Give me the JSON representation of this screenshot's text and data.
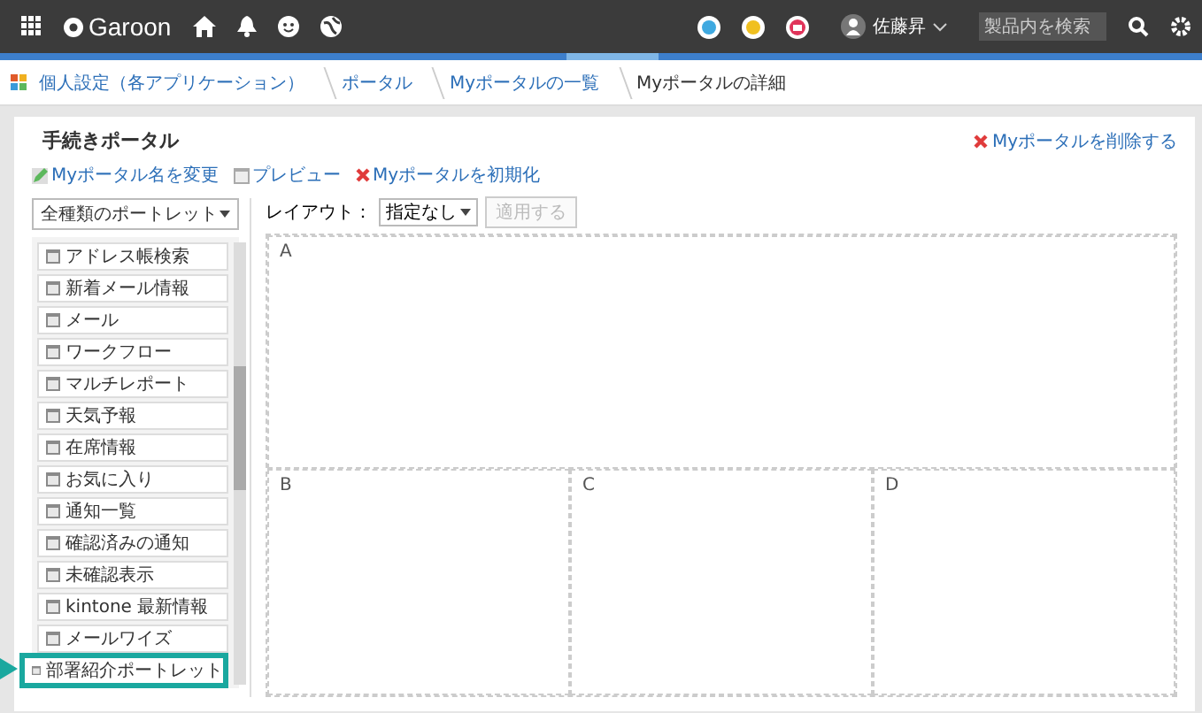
{
  "header": {
    "logo": "Garoon",
    "user": "佐藤昇",
    "search": {
      "placeholder": "製品内を検索"
    }
  },
  "breadcrumb": [
    "個人設定（各アプリケーション）",
    "ポータル",
    "Myポータルの一覧",
    "Myポータルの詳細"
  ],
  "page": {
    "title": "手続きポータル",
    "delete_link": "Myポータルを削除する",
    "actions": [
      "Myポータル名を変更",
      "プレビュー",
      "Myポータルを初期化"
    ]
  },
  "portlet_filter": "全種類のポートレット",
  "portlets": [
    {
      "label": "アドレス帳検索",
      "highlighted": false
    },
    {
      "label": "新着メール情報",
      "highlighted": false
    },
    {
      "label": "メール",
      "highlighted": false
    },
    {
      "label": "ワークフロー",
      "highlighted": false
    },
    {
      "label": "マルチレポート",
      "highlighted": false
    },
    {
      "label": "天気予報",
      "highlighted": false
    },
    {
      "label": "在席情報",
      "highlighted": false
    },
    {
      "label": "お気に入り",
      "highlighted": false
    },
    {
      "label": "通知一覧",
      "highlighted": false
    },
    {
      "label": "確認済みの通知",
      "highlighted": false
    },
    {
      "label": "未確認表示",
      "highlighted": false
    },
    {
      "label": "kintone 最新情報",
      "highlighted": false
    },
    {
      "label": "メールワイズ",
      "highlighted": false
    },
    {
      "label": "部署紹介ポートレット",
      "highlighted": true
    }
  ],
  "layout": {
    "label": "レイアウト：",
    "value": "指定なし",
    "apply": "適用する",
    "apply_disabled": true,
    "areas": [
      "A",
      "B",
      "C",
      "D"
    ]
  }
}
